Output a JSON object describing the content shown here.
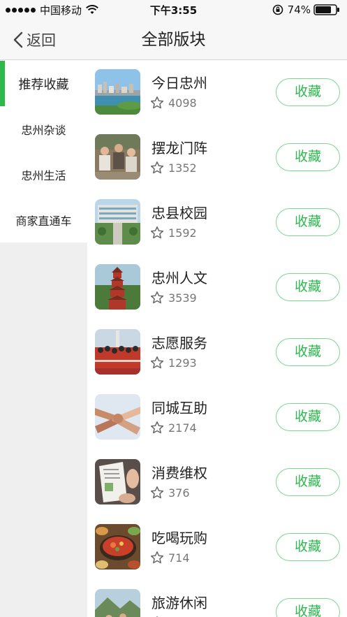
{
  "status_bar": {
    "carrier": "中国移动",
    "time": "下午3:55",
    "battery": "74%",
    "icons": [
      "signal-dots-icon",
      "wifi-icon",
      "rotation-lock-icon",
      "battery-icon"
    ]
  },
  "nav": {
    "back_label": "返回",
    "title": "全部版块"
  },
  "sidebar": {
    "items": [
      {
        "label": "推荐收藏",
        "active": true
      },
      {
        "label": "忠州杂谈",
        "active": false
      },
      {
        "label": "忠州生活",
        "active": false
      },
      {
        "label": "商家直通车",
        "active": false
      }
    ]
  },
  "colors": {
    "accent": "#2db84d",
    "button_border": "#7dd88f",
    "sidebar_bg": "#efefef",
    "nav_bg": "#f7f7f7"
  },
  "boards": [
    {
      "title": "今日忠州",
      "count": "4098",
      "button": "收藏",
      "icon": "city-photo-icon"
    },
    {
      "title": "摆龙门阵",
      "count": "1352",
      "button": "收藏",
      "icon": "people-chat-photo-icon"
    },
    {
      "title": "忠县校园",
      "count": "1592",
      "button": "收藏",
      "icon": "campus-photo-icon"
    },
    {
      "title": "忠州人文",
      "count": "3539",
      "button": "收藏",
      "icon": "pagoda-photo-icon"
    },
    {
      "title": "志愿服务",
      "count": "1293",
      "button": "收藏",
      "icon": "volunteers-photo-icon"
    },
    {
      "title": "同城互助",
      "count": "2174",
      "button": "收藏",
      "icon": "hands-photo-icon"
    },
    {
      "title": "消费维权",
      "count": "376",
      "button": "收藏",
      "icon": "document-photo-icon"
    },
    {
      "title": "吃喝玩购",
      "count": "714",
      "button": "收藏",
      "icon": "food-photo-icon"
    },
    {
      "title": "旅游休闲",
      "count": "",
      "button": "收藏",
      "icon": "travel-photo-icon"
    }
  ]
}
